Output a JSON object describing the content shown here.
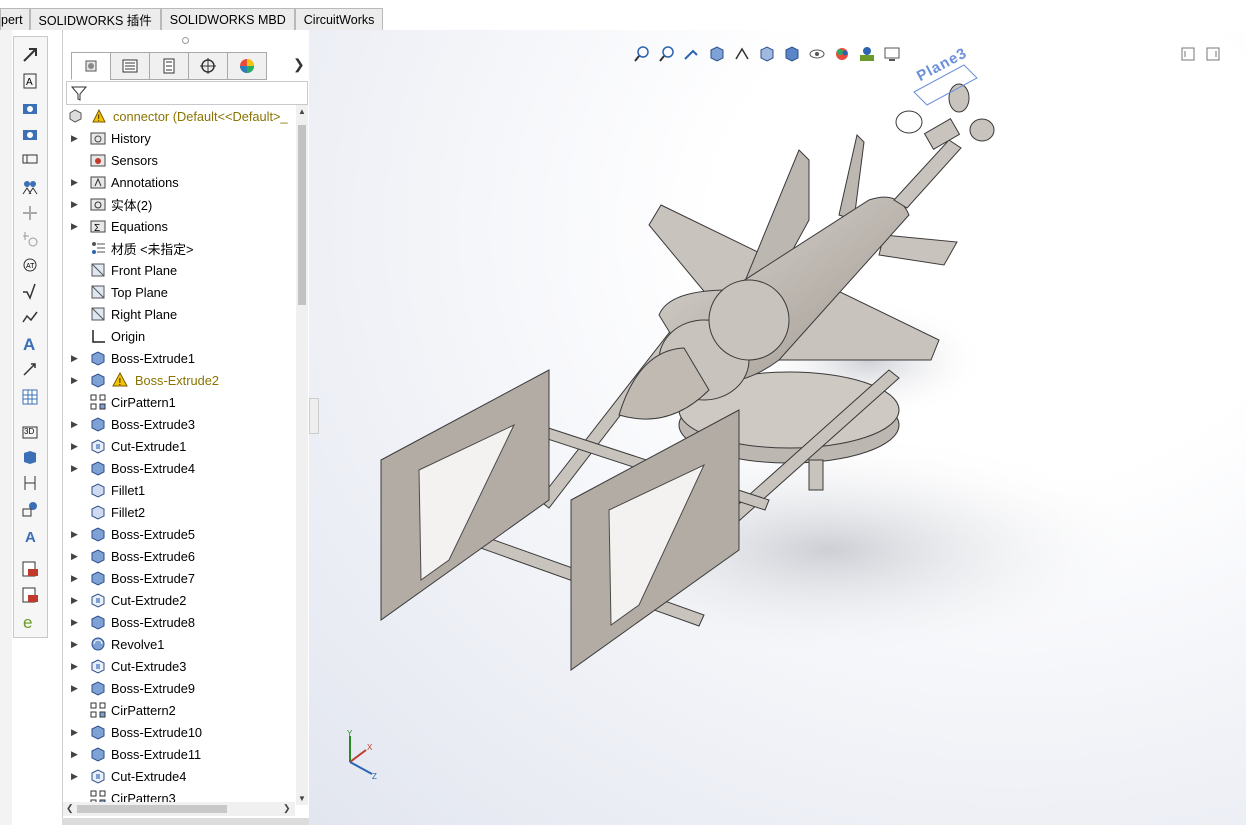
{
  "tabs": [
    "pert",
    "SOLIDWORKS 插件",
    "SOLIDWORKS MBD",
    "CircuitWorks"
  ],
  "feature_tree": {
    "root": {
      "label": "connector  (Default<<Default>_",
      "icon": "part-icon",
      "warning": true
    },
    "items": [
      {
        "label": "History",
        "icon": "history-folder-icon",
        "expandable": true
      },
      {
        "label": "Sensors",
        "icon": "sensors-folder-icon",
        "expandable": false
      },
      {
        "label": "Annotations",
        "icon": "annotations-folder-icon",
        "expandable": true
      },
      {
        "label": "实体(2)",
        "icon": "solid-bodies-folder-icon",
        "expandable": true
      },
      {
        "label": "Equations",
        "icon": "equations-folder-icon",
        "expandable": true
      },
      {
        "label": "材质 <未指定>",
        "icon": "material-icon",
        "expandable": false
      },
      {
        "label": "Front Plane",
        "icon": "plane-icon",
        "expandable": false
      },
      {
        "label": "Top Plane",
        "icon": "plane-icon",
        "expandable": false
      },
      {
        "label": "Right Plane",
        "icon": "plane-icon",
        "expandable": false
      },
      {
        "label": "Origin",
        "icon": "origin-icon",
        "expandable": false
      },
      {
        "label": "Boss-Extrude1",
        "icon": "boss-extrude-icon",
        "expandable": true
      },
      {
        "label": "Boss-Extrude2",
        "icon": "boss-extrude-icon",
        "expandable": true,
        "warning": true
      },
      {
        "label": "CirPattern1",
        "icon": "circular-pattern-icon",
        "expandable": false
      },
      {
        "label": "Boss-Extrude3",
        "icon": "boss-extrude-icon",
        "expandable": true
      },
      {
        "label": "Cut-Extrude1",
        "icon": "cut-extrude-icon",
        "expandable": true
      },
      {
        "label": "Boss-Extrude4",
        "icon": "boss-extrude-icon",
        "expandable": true
      },
      {
        "label": "Fillet1",
        "icon": "fillet-icon",
        "expandable": false
      },
      {
        "label": "Fillet2",
        "icon": "fillet-icon",
        "expandable": false
      },
      {
        "label": "Boss-Extrude5",
        "icon": "boss-extrude-icon",
        "expandable": true
      },
      {
        "label": "Boss-Extrude6",
        "icon": "boss-extrude-icon",
        "expandable": true
      },
      {
        "label": "Boss-Extrude7",
        "icon": "boss-extrude-icon",
        "expandable": true
      },
      {
        "label": "Cut-Extrude2",
        "icon": "cut-extrude-icon",
        "expandable": true
      },
      {
        "label": "Boss-Extrude8",
        "icon": "boss-extrude-icon",
        "expandable": true
      },
      {
        "label": "Revolve1",
        "icon": "revolve-icon",
        "expandable": true
      },
      {
        "label": "Cut-Extrude3",
        "icon": "cut-extrude-icon",
        "expandable": true
      },
      {
        "label": "Boss-Extrude9",
        "icon": "boss-extrude-icon",
        "expandable": true
      },
      {
        "label": "CirPattern2",
        "icon": "circular-pattern-icon",
        "expandable": false
      },
      {
        "label": "Boss-Extrude10",
        "icon": "boss-extrude-icon",
        "expandable": true
      },
      {
        "label": "Boss-Extrude11",
        "icon": "boss-extrude-icon",
        "expandable": true
      },
      {
        "label": "Cut-Extrude4",
        "icon": "cut-extrude-icon",
        "expandable": true
      },
      {
        "label": "CirPattern3",
        "icon": "circular-pattern-icon",
        "expandable": false
      }
    ]
  },
  "manager_tabs": [
    "featuremanager-icon",
    "propertymanager-icon",
    "configurationmanager-icon",
    "dimxpert-icon",
    "display-manager-icon"
  ],
  "heads_up_toolbar": [
    "zoom-to-fit-icon",
    "zoom-to-area-icon",
    "previous-view-icon",
    "section-view-icon",
    "dynamic-annotation-icon",
    "view-orientation-icon",
    "display-style-icon",
    "hide-show-icon",
    "edit-appearance-icon",
    "apply-scene-icon",
    "view-settings-icon"
  ],
  "command_bar": [
    "sketch-icon",
    "smart-dimension-icon",
    "model-items-icon",
    "spell-checker-icon",
    "format-painter-icon",
    "note-icon",
    "linear-pattern-icon",
    "balloon-icon",
    "auto-balloon-icon",
    "magnetic-line-icon",
    "surface-finish-icon",
    "weld-symbol-icon",
    "geometric-tolerance-icon",
    "datum-feature-icon",
    "table-icon",
    "3d-view-icon",
    "hole-callout-icon",
    "revision-symbol-icon",
    "publish-pdf-icon",
    "publish-edrawings-icon"
  ],
  "viewport": {
    "plane_label": "Plane3",
    "model": "connector 3D model",
    "colors": {
      "part": "#c9c3bd",
      "edge": "#3a3a3a",
      "plane_text": "#6b8fd8"
    }
  }
}
